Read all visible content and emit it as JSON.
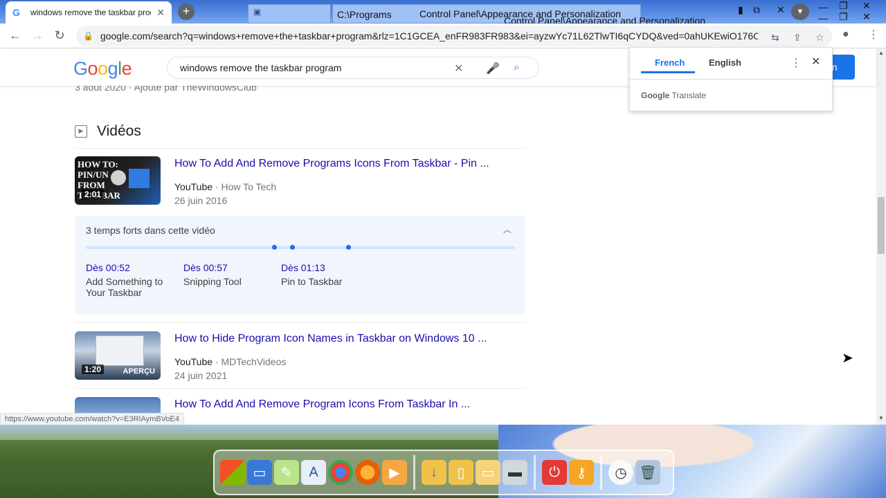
{
  "tab": {
    "title": "windows remove the taskbar program",
    "close": "✕"
  },
  "window_titles": {
    "programs": "C:\\Programs",
    "appearance_1": "Control Panel\\Appearance and Personalization",
    "appearance_2": "Control Panel\\Appearance and Personalization"
  },
  "omnibox": {
    "url": "google.com/search?q=windows+remove+the+taskbar+program&rlz=1C1GCEA_enFR983FR983&ei=ayzwYc71L62TlwTI6qCYDQ&ved=0ahUKEwiO176Os..."
  },
  "google": {
    "logo": "Google",
    "query": "windows remove the taskbar program",
    "signin_label": "on"
  },
  "results": {
    "meta_top": "3 août 2020 · Ajouté par TheWindowsClub",
    "videos_heading": "Vidéos",
    "videos": [
      {
        "title": "How To Add And Remove Programs Icons From Taskbar - Pin ...",
        "site": "YouTube",
        "channel": "How To Tech",
        "date": "26 juin 2016",
        "duration": "2:01",
        "thumb_text": "HOW TO: PIN/UN FROM TASKBAR"
      },
      {
        "title": "How to Hide Program Icon Names in Taskbar on Windows 10 ...",
        "site": "YouTube",
        "channel": "MDTechVideos",
        "date": "24 juin 2021",
        "duration": "1:20",
        "badge": "APERÇU"
      },
      {
        "title": "How To Add And Remove Program Icons From Taskbar In ..."
      }
    ],
    "key_moments": {
      "heading": "3 temps forts dans cette vidéo",
      "progress_points": [
        0.434,
        0.476,
        0.606
      ],
      "items": [
        {
          "time": "Dès 00:52",
          "label": "Add Something to Your Taskbar"
        },
        {
          "time": "Dès 00:57",
          "label": "Snipping Tool"
        },
        {
          "time": "Dès 01:13",
          "label": "Pin to Taskbar"
        }
      ]
    }
  },
  "status_url": "https://www.youtube.com/watch?v=E3RIAymBVoE4",
  "translate": {
    "lang_active": "French",
    "lang_other": "English",
    "brand_google": "Google",
    "brand_translate": "Translate"
  }
}
